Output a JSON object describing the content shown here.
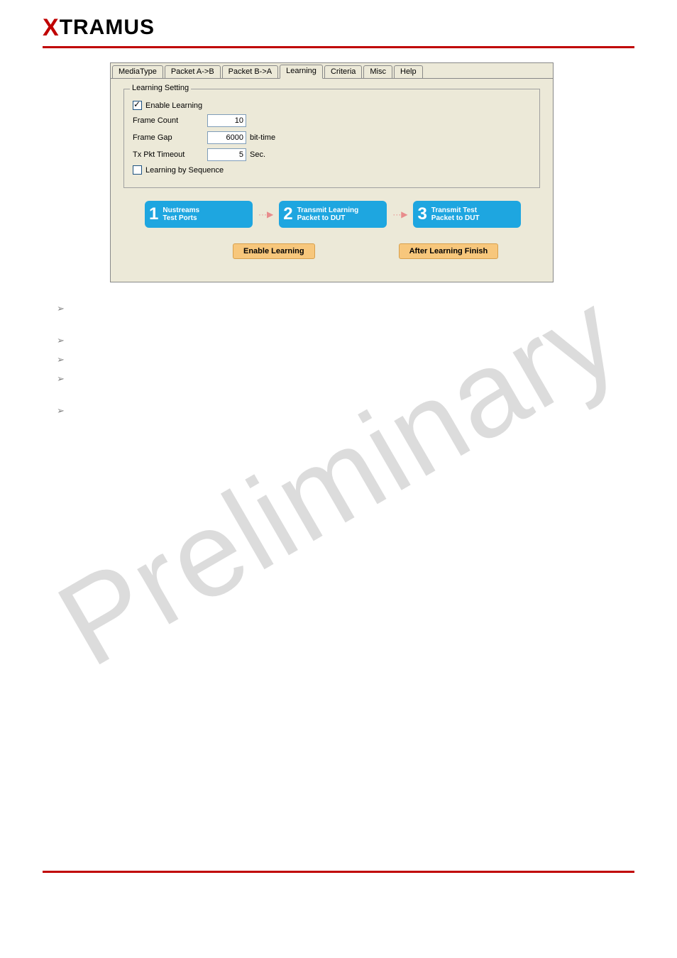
{
  "logo": {
    "rest": "TRAMUS"
  },
  "watermark": "Preliminary",
  "tabs": {
    "mediatype": "MediaType",
    "packetab": "Packet A->B",
    "packetba": "Packet B->A",
    "learning": "Learning",
    "criteria": "Criteria",
    "misc": "Misc",
    "help": "Help"
  },
  "fieldset": {
    "legend": "Learning Setting",
    "enable_label": "Enable Learning",
    "framecount_label": "Frame Count",
    "framecount_value": "10",
    "framegap_label": "Frame Gap",
    "framegap_value": "6000",
    "framegap_unit": "bit-time",
    "timeout_label": "Tx Pkt Timeout",
    "timeout_value": "5",
    "timeout_unit": "Sec.",
    "seq_label": "Learning by Sequence"
  },
  "flow": {
    "step1_line1": "Nustreams",
    "step1_line2": "Test Ports",
    "step2_line1": "Transmit Learning",
    "step2_line2": "Packet to DUT",
    "step3_line1": "Transmit Test",
    "step3_line2": "Packet to DUT",
    "label1": "Enable Learning",
    "label2": "After Learning Finish"
  }
}
